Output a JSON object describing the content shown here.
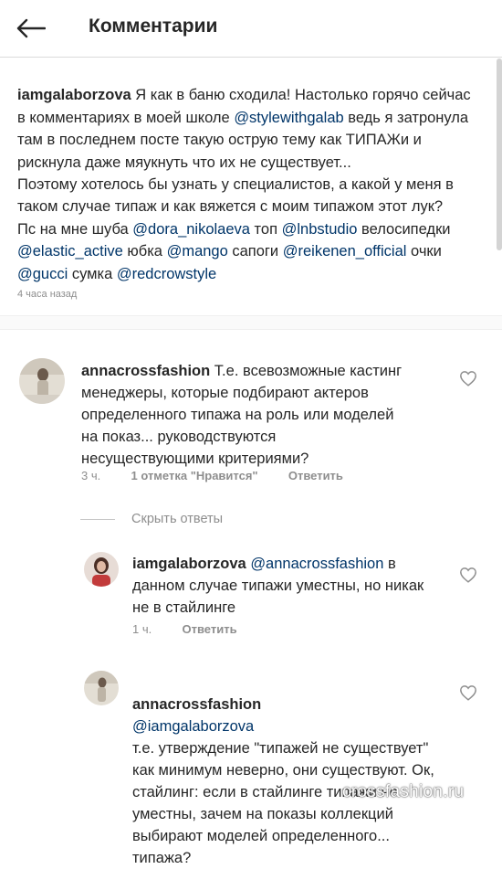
{
  "header": {
    "title": "Комментарии",
    "back_icon": "arrow-left-icon"
  },
  "caption": {
    "username": "iamgalaborzova",
    "segments": [
      {
        "t": " Я как в баню сходила! Настолько горячо сейчас в комментариях в моей школе ",
        "m": false
      },
      {
        "t": "@stylewithgalab",
        "m": true
      },
      {
        "t": " ведь я затронула там в последнем посте такую острую тему как ТИПАЖи и рискнула даже мяукнуть что их не существует...",
        "m": false
      },
      {
        "t": "\nПоэтому хотелось бы узнать у специалистов, а какой у меня в таком случае типаж и как вяжется с моим типажом этот лук?",
        "m": false
      },
      {
        "t": "\nПс на мне шуба ",
        "m": false
      },
      {
        "t": "@dora_nikolaeva",
        "m": true
      },
      {
        "t": " топ ",
        "m": false
      },
      {
        "t": "@lnbstudio",
        "m": true
      },
      {
        "t": " велосипедки ",
        "m": false
      },
      {
        "t": "@elastic_active",
        "m": true
      },
      {
        "t": " юбка ",
        "m": false
      },
      {
        "t": "@mango",
        "m": true
      },
      {
        "t": " сапоги ",
        "m": false
      },
      {
        "t": "@reikenen_official",
        "m": true
      },
      {
        "t": " очки ",
        "m": false
      },
      {
        "t": "@gucci",
        "m": true
      },
      {
        "t": " сумка ",
        "m": false
      },
      {
        "t": "@redcrowstyle",
        "m": true
      }
    ],
    "timestamp": "4 часа назад"
  },
  "comments": [
    {
      "username": "annacrossfashion",
      "text": " Т.е. всевозможные кастинг менеджеры, которые подбирают актеров определенного типажа на роль или моделей на показ... руководствуются несуществующими критериями?",
      "time": "3 ч.",
      "likes": "1 отметка \"Нравится\"",
      "reply": "Ответить"
    },
    {
      "username": "iamgalaborzova",
      "mention": "@annacrossfashion",
      "text": " в данном случае типажи уместны, но никак не в стайлинге",
      "time": "1 ч.",
      "reply": "Ответить"
    },
    {
      "username": "annacrossfashion",
      "mention": "@iamgalaborzova",
      "text": "\nт.е. утверждение \"типажей не существует\" как минимум неверно, они существуют. Ок, стайлинг: если  в стайлинге типажи не уместны, зачем на показы коллекций выбирают моделей определенного... типажа?"
    }
  ],
  "hide_replies": "Скрыть ответы",
  "watermark": "crossfashion.ru",
  "colors": {
    "mention": "#003569",
    "text": "#262626",
    "muted": "#8e8e8e",
    "divider": "#dbdbdb"
  }
}
